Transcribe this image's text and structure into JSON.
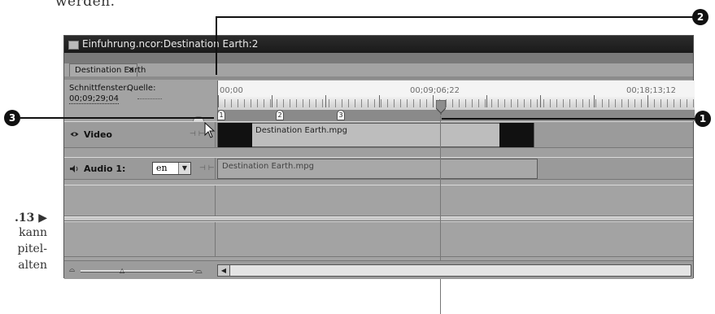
{
  "book": {
    "top_text": "werden.",
    "side_label": ".13 ▶",
    "side_line_1": "kann",
    "side_line_2": "pitel-",
    "side_line_3": "alten"
  },
  "window": {
    "title": "Einfuhrung.ncor:Destination Earth:2"
  },
  "tab": {
    "label": "Destination Earth",
    "close": "✕"
  },
  "info": {
    "schedule_label": "Schnittfenster:",
    "source_label": "Quelle:",
    "timecode": "00;09;29;04"
  },
  "ruler": {
    "timecodes": [
      "00;00",
      "00;09;06;22",
      "00;18;13;12"
    ],
    "chapter_markers": [
      "1",
      "2",
      "3"
    ]
  },
  "tracks": {
    "video": {
      "name": "Video",
      "sync": "⊣ ⊢",
      "clip_title": "Destination Earth.mpg"
    },
    "audio": {
      "name": "Audio 1:",
      "language": "en",
      "sync": "⊣ ⊢",
      "clip_title": "Destination Earth.mpg"
    }
  },
  "bottom": {
    "zoom_small": "⌓",
    "zoom_thumb": "△",
    "zoom_big": "⌓",
    "scroll_left": "◀"
  },
  "callouts": {
    "one": "1",
    "two": "2",
    "three": "3"
  },
  "colors": {
    "panel": "#a3a3a3",
    "titlebar": "#1f1f1f",
    "callout": "#111111"
  }
}
